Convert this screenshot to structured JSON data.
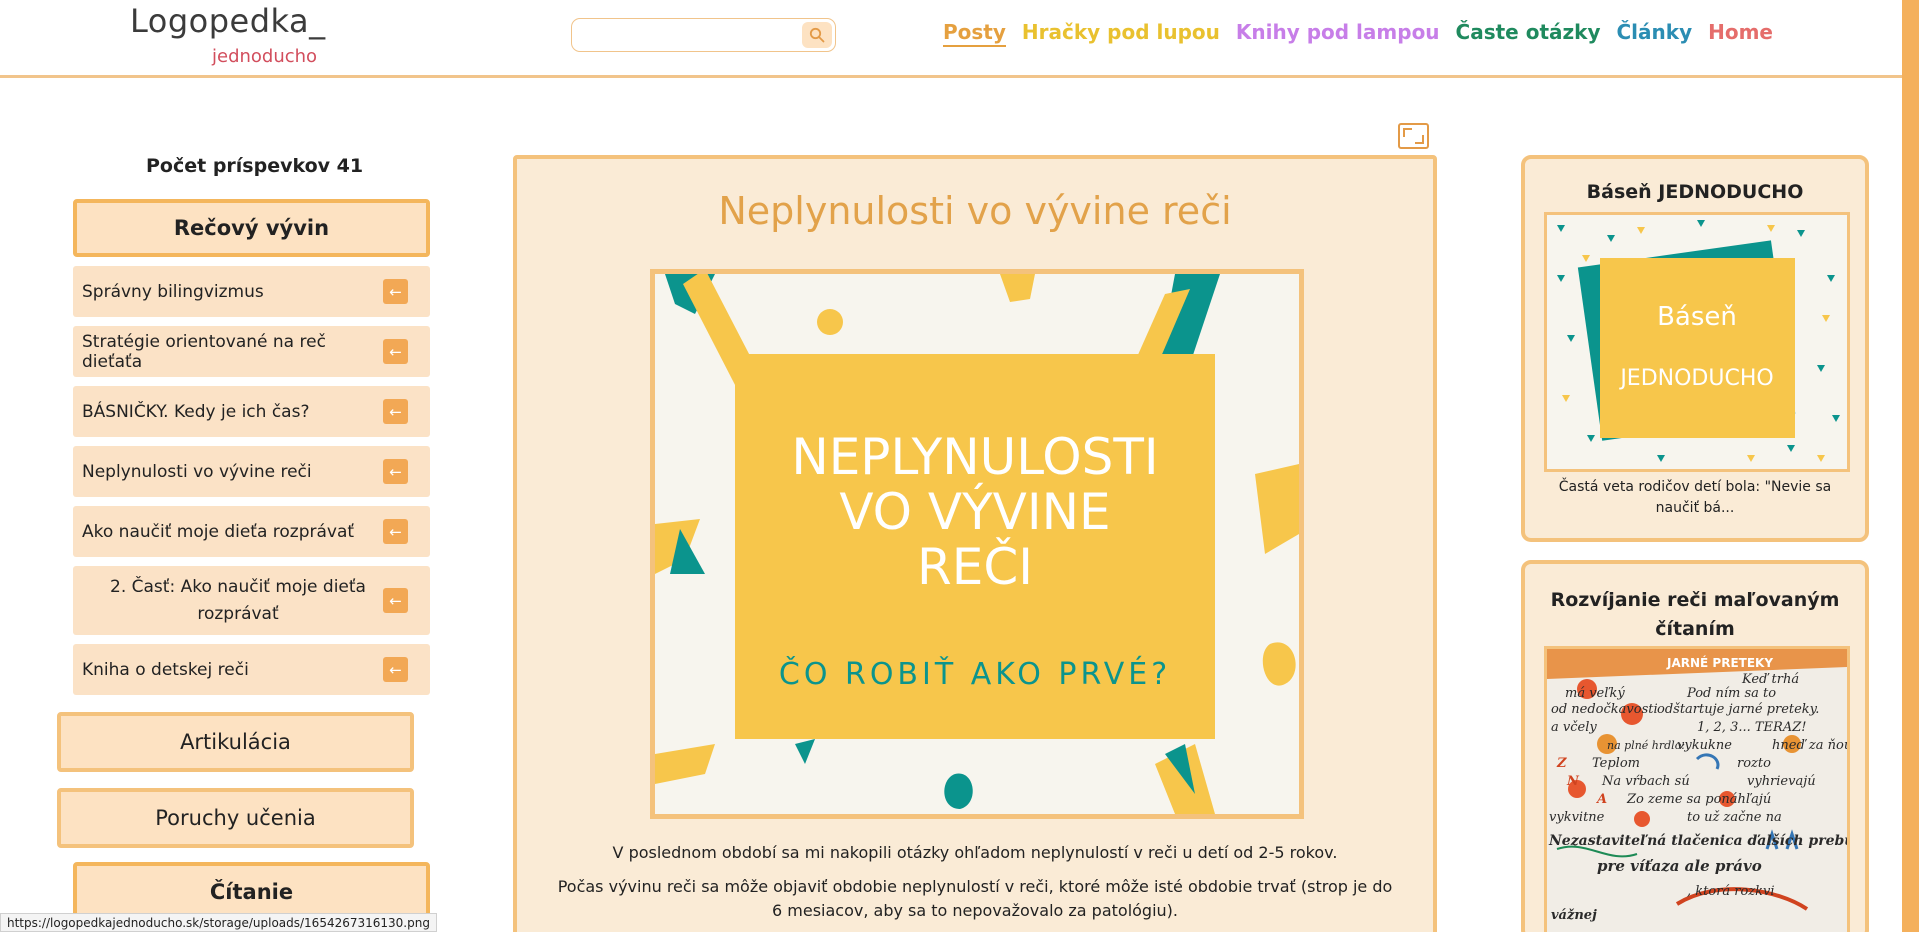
{
  "header": {
    "logo_main": "Logopedka_",
    "logo_sub": "jednoducho",
    "search_placeholder": "",
    "nav": [
      "Posty",
      "Hračky pod lupou",
      "Knihy pod lampou",
      "Časte otázky",
      "Články",
      "Home"
    ]
  },
  "sidebar": {
    "count_label": "Počet príspevkov 41",
    "active_category": "Rečový vývin",
    "items": [
      "Správny bilingvizmus",
      "Stratégie orientované na reč dieťaťa",
      "BÁSNIČKY. Kedy je ich čas?",
      "Neplynulosti vo vývine reči",
      "Ako naučiť moje dieťa rozprávať",
      "2. Časť: Ako naučiť moje dieťa rozprávať",
      "Kniha o detskej reči"
    ],
    "categories": [
      "Artikulácia",
      "Poruchy učenia",
      "Čítanie"
    ]
  },
  "main": {
    "title": "Neplynulosti vo vývine reči",
    "hero_text_1": "NEPLYNULOSTI",
    "hero_text_2": "VO VÝVINE",
    "hero_text_3": "REČI",
    "hero_subtext": "ČO ROBIŤ AKO PRVÉ?",
    "paragraph_1": "V poslednom období sa mi nakopili otázky ohľadom neplynulostí v reči u detí od 2-5 rokov.",
    "paragraph_2": "Počas vývinu reči sa môže objaviť obdobie neplynulostí v reči, ktoré môže isté obdobie trvať (strop je do 6 mesiacov, aby sa to nepovažovalo za patológiu)."
  },
  "right": {
    "card1_title": "Báseň JEDNODUCHO",
    "card1_img_line1": "Báseň",
    "card1_img_line2": "JEDNODUCHO",
    "card1_text": "Častá veta rodičov detí bola: \"Nevie sa naučiť bá...",
    "card2_title": "Rozvíjanie reči maľovaným čítaním",
    "card2_img_title": "JARNÉ PRETEKY",
    "card2_img_words": [
      "Keď trhá",
      "má veľký",
      "Pod ním sa to",
      "od nedočkavosti",
      "odštartuje jarné preteky.",
      "a včely",
      "na plné hrdlo:",
      "1, 2, 3... TERAZ!",
      "vykukne",
      "hneď za ňou",
      "Z",
      "Teplom",
      "rozto",
      "N",
      "Na vŕbach sú",
      "vyhrievajú",
      "A",
      "Zo zeme sa ponáhľajú",
      "vykvitne",
      "to už začne na",
      "Nezastaviteľná tlačenica ďalších prebud",
      "pre víťaza ale právo",
      ", ktorá rozkvi",
      "vážnej"
    ]
  },
  "status_url": "https://logopedkajednoducho.sk/storage/uploads/1654267316130.png",
  "colors": {
    "accent": "#f4c27c",
    "card_bg": "#faebd6",
    "hero_yellow": "#f7c64b",
    "teal": "#0b948d"
  }
}
